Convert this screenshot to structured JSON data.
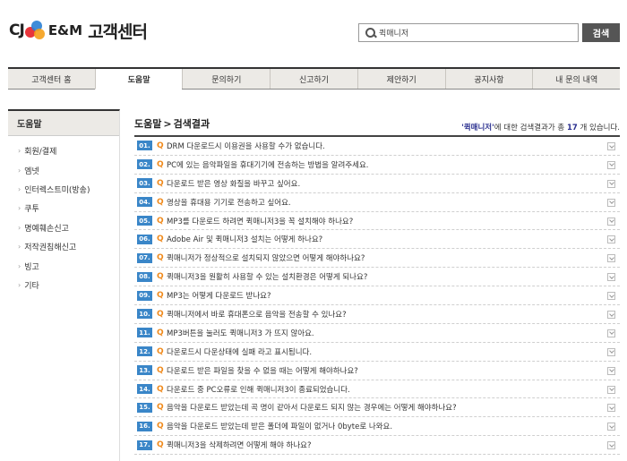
{
  "header": {
    "logo_cj": "CJ",
    "logo_em": "E&M",
    "logo_title": "고객센터",
    "search_value": "퀵매니저",
    "search_button": "검색"
  },
  "gnb": [
    {
      "label": "고객센터 홈"
    },
    {
      "label": "도움말"
    },
    {
      "label": "문의하기"
    },
    {
      "label": "신고하기"
    },
    {
      "label": "제안하기"
    },
    {
      "label": "공지사항"
    },
    {
      "label": "내 문의 내역"
    }
  ],
  "lnb": {
    "title": "도움말",
    "items": [
      {
        "label": "회원/결제"
      },
      {
        "label": "엠넷"
      },
      {
        "label": "인터렉스트미(방송)"
      },
      {
        "label": "쿠투"
      },
      {
        "label": "명예훼손신고"
      },
      {
        "label": "저작권침해신고"
      },
      {
        "label": "빙고"
      },
      {
        "label": "기타"
      }
    ]
  },
  "content": {
    "title_a": "도움말",
    "title_sep": ">",
    "title_b": "검색결과",
    "result_kw": "'퀵매니저'",
    "result_mid": "에 대한 검색결과가 총",
    "result_count": "17",
    "result_end": "개 있습니다."
  },
  "faq": [
    {
      "num": "01.",
      "q": "Q",
      "text": "DRM 다운로드시 이용권을 사용할 수가 없습니다."
    },
    {
      "num": "02.",
      "q": "Q",
      "text": "PC에 있는 음악파일을 휴대기기에 전송하는 방법을 알려주세요."
    },
    {
      "num": "03.",
      "q": "Q",
      "text": "다운로드 받은 영상 화질을 바꾸고 싶어요."
    },
    {
      "num": "04.",
      "q": "Q",
      "text": "영상을 휴대용 기기로 전송하고 싶어요."
    },
    {
      "num": "05.",
      "q": "Q",
      "text": "MP3를 다운로드 하려면 퀵매니저3을 꼭 설치해야 하나요?"
    },
    {
      "num": "06.",
      "q": "Q",
      "text": "Adobe Air 및 퀵매니저3 설치는 어떻게 하나요?"
    },
    {
      "num": "07.",
      "q": "Q",
      "text": "퀵매니저가 정상적으로 설치되지 않았으면 어떻게 해야하나요?"
    },
    {
      "num": "08.",
      "q": "Q",
      "text": "퀵매니저3을 원활히 사용할 수 있는 설치환경은 어떻게 되나요?"
    },
    {
      "num": "09.",
      "q": "Q",
      "text": "MP3는 어떻게 다운로드 받나요?"
    },
    {
      "num": "10.",
      "q": "Q",
      "text": "퀵매니저에서 바로 휴대폰으로 음악을 전송할 수 있나요?"
    },
    {
      "num": "11.",
      "q": "Q",
      "text": "MP3버튼을 눌러도 퀵매니저3 가 뜨지 않아요."
    },
    {
      "num": "12.",
      "q": "Q",
      "text": "다운로드시 다운상태에 실패 라고 표시됩니다."
    },
    {
      "num": "13.",
      "q": "Q",
      "text": "다운로드 받은 파일을 찾을 수 없을 때는 어떻게 해야하나요?"
    },
    {
      "num": "14.",
      "q": "Q",
      "text": "다운로드 중 PC오류로 인해 퀵매니저3이 종료되었습니다."
    },
    {
      "num": "15.",
      "q": "Q",
      "text": "음악을 다운로드 받았는데 곡 명이 같아서 다운로드 되지 않는 경우에는 어떻게 해야하나요?"
    },
    {
      "num": "16.",
      "q": "Q",
      "text": "음악을 다운로드 받았는데 받은 폴더에 파일이 없거나 0byte로 나와요."
    },
    {
      "num": "17.",
      "q": "Q",
      "text": "퀵매니저3을 삭제하려면 어떻게 해야 하나요?"
    }
  ]
}
